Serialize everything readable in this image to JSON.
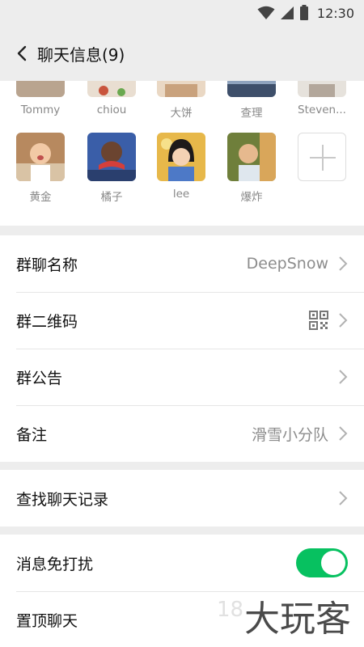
{
  "status_bar": {
    "time": "12:30",
    "icons": [
      "wifi-icon",
      "cellular-signal-icon",
      "battery-icon"
    ]
  },
  "nav": {
    "title": "聊天信息(9)",
    "back_icon": "chevron-left-icon"
  },
  "members": {
    "row1": [
      {
        "name": "Tommy"
      },
      {
        "name": "chiou"
      },
      {
        "name": "大饼"
      },
      {
        "name": "查理"
      },
      {
        "name": "Steven..."
      }
    ],
    "row2": [
      {
        "name": "黄金"
      },
      {
        "name": "橘子"
      },
      {
        "name": "lee"
      },
      {
        "name": "爆炸"
      }
    ],
    "add_icon": "plus-icon"
  },
  "settings": {
    "group_name": {
      "label": "群聊名称",
      "value": "DeepSnow"
    },
    "qr_code": {
      "label": "群二维码"
    },
    "announcement": {
      "label": "群公告"
    },
    "remark": {
      "label": "备注",
      "value": "滑雪小分队"
    },
    "search_history": {
      "label": "查找聊天记录"
    },
    "mute": {
      "label": "消息免打扰",
      "enabled": true
    },
    "pin": {
      "label": "置顶聊天"
    }
  },
  "watermark": {
    "text": "大玩客"
  },
  "colors": {
    "accent": "#07c160",
    "background": "#ededed"
  }
}
